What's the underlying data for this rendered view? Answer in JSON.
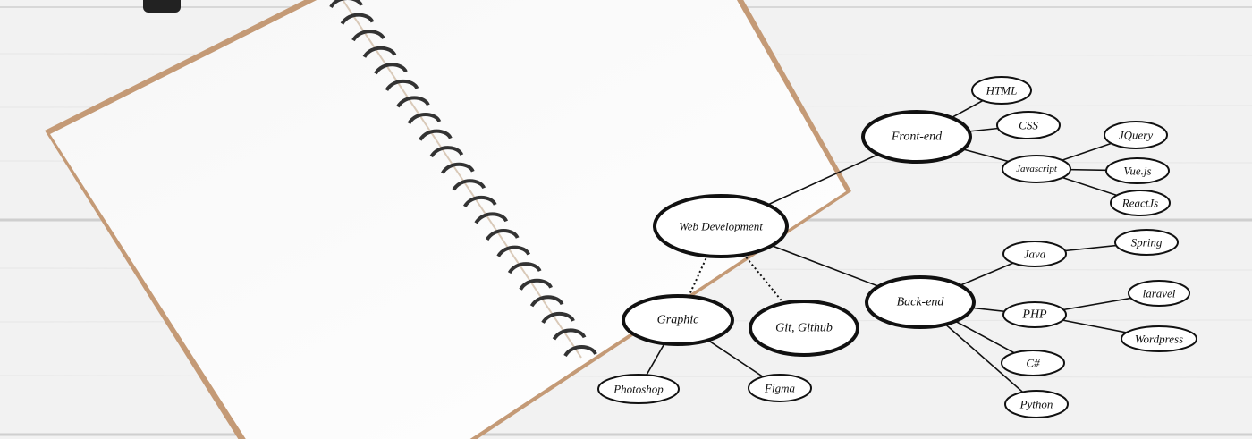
{
  "diagram": {
    "nodes": [
      {
        "id": "web",
        "label": "Web Development"
      },
      {
        "id": "front",
        "label": "Front-end"
      },
      {
        "id": "html",
        "label": "HTML"
      },
      {
        "id": "css",
        "label": "CSS"
      },
      {
        "id": "js",
        "label": "Javascript"
      },
      {
        "id": "jquery",
        "label": "JQuery"
      },
      {
        "id": "vue",
        "label": "Vue.js"
      },
      {
        "id": "react",
        "label": "ReactJs"
      },
      {
        "id": "back",
        "label": "Back-end"
      },
      {
        "id": "java",
        "label": "Java"
      },
      {
        "id": "spring",
        "label": "Spring"
      },
      {
        "id": "php",
        "label": "PHP"
      },
      {
        "id": "laravel",
        "label": "laravel"
      },
      {
        "id": "wordpress",
        "label": "Wordpress"
      },
      {
        "id": "csharp",
        "label": "C#"
      },
      {
        "id": "python",
        "label": "Python"
      },
      {
        "id": "graphic",
        "label": "Graphic"
      },
      {
        "id": "git",
        "label": "Git, Github"
      },
      {
        "id": "photoshop",
        "label": "Photoshop"
      },
      {
        "id": "figma",
        "label": "Figma"
      }
    ],
    "edges": [
      {
        "from": "web",
        "to": "front",
        "style": "solid"
      },
      {
        "from": "web",
        "to": "back",
        "style": "solid"
      },
      {
        "from": "web",
        "to": "graphic",
        "style": "dotted"
      },
      {
        "from": "web",
        "to": "git",
        "style": "dotted"
      },
      {
        "from": "front",
        "to": "html",
        "style": "solid"
      },
      {
        "from": "front",
        "to": "css",
        "style": "solid"
      },
      {
        "from": "front",
        "to": "js",
        "style": "solid"
      },
      {
        "from": "js",
        "to": "jquery",
        "style": "solid"
      },
      {
        "from": "js",
        "to": "vue",
        "style": "solid"
      },
      {
        "from": "js",
        "to": "react",
        "style": "solid"
      },
      {
        "from": "back",
        "to": "java",
        "style": "solid"
      },
      {
        "from": "back",
        "to": "php",
        "style": "solid"
      },
      {
        "from": "back",
        "to": "csharp",
        "style": "solid"
      },
      {
        "from": "back",
        "to": "python",
        "style": "solid"
      },
      {
        "from": "java",
        "to": "spring",
        "style": "solid"
      },
      {
        "from": "php",
        "to": "laravel",
        "style": "solid"
      },
      {
        "from": "php",
        "to": "wordpress",
        "style": "solid"
      },
      {
        "from": "graphic",
        "to": "photoshop",
        "style": "solid"
      },
      {
        "from": "graphic",
        "to": "figma",
        "style": "solid"
      }
    ]
  },
  "colors": {
    "background": "#f3f3f3",
    "page": "#fbfbfb",
    "page_edge": "#c49a76",
    "ink": "#111111"
  }
}
